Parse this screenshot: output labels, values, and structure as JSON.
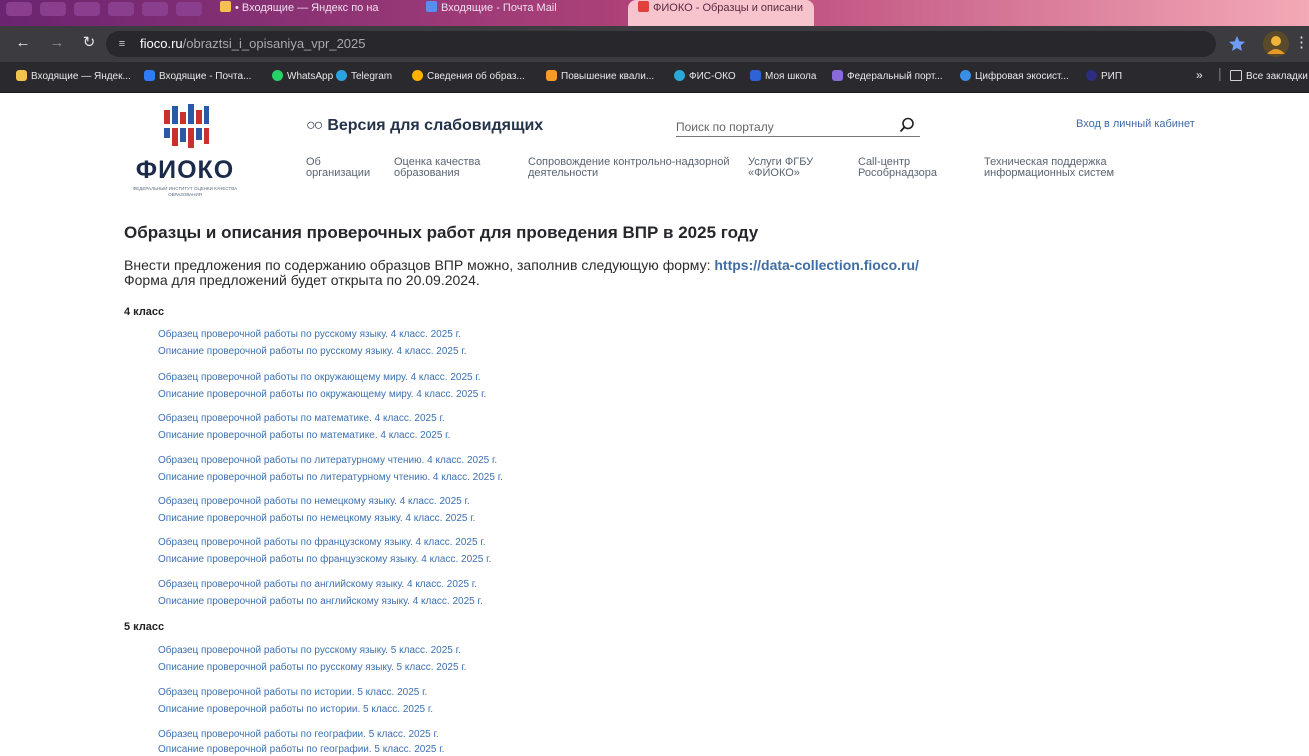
{
  "browser": {
    "tabs": [
      {
        "title": "• Входящие — Яндекс по на",
        "favicon_color": "#f2c14e",
        "active": false
      },
      {
        "title": "Входящие - Почта Mail",
        "favicon_color": "#5a8df0",
        "active": false
      },
      {
        "title": "ФИОКО - Образцы и описани",
        "favicon_color": "#e0413a",
        "active": true
      }
    ],
    "url_host": "fioco.ru",
    "url_path": "/obraztsi_i_opisaniya_vpr_2025",
    "bookmarks": [
      {
        "label": "Входящие — Яндек...",
        "color": "#f2c14e"
      },
      {
        "label": "Входящие - Почта...",
        "color": "#2f7cf6"
      },
      {
        "label": "WhatsApp",
        "color": "#25d366"
      },
      {
        "label": "Telegram",
        "color": "#2aa3e0"
      },
      {
        "label": "Сведения об образ...",
        "color": "#ffb300"
      },
      {
        "label": "Повышение квали...",
        "color": "#f59b2a"
      },
      {
        "label": "ФИС-ОКО",
        "color": "#2aa8d8"
      },
      {
        "label": "Моя школа",
        "color": "#2f62d6"
      },
      {
        "label": "Федеральный порт...",
        "color": "#8a6ad8"
      },
      {
        "label": "Цифровая экосист...",
        "color": "#3a8ee6"
      },
      {
        "label": "РИП",
        "color": "#2c2c80"
      }
    ],
    "bookmarks_overflow": "»",
    "all_bookmarks": "Все закладки"
  },
  "header": {
    "logo_text": "ФИОКО",
    "logo_subtitle": "Федеральный институт оценки качества образования",
    "low_vision": "Версия для слабовидящих",
    "search_placeholder": "Поиск по порталу",
    "login": "Вход в личный кабинет",
    "nav": [
      "Об\nорганизации",
      "Оценка качества\nобразования",
      "Сопровождение контрольно-надзорной\nдеятельности",
      "Услуги ФГБУ\n«ФИОКО»",
      "Call-центр\nРособрнадзора",
      "Техническая поддержка\nинформационных систем"
    ]
  },
  "main": {
    "title": "Образцы и описания проверочных работ для проведения ВПР в 2025 году",
    "intro_text": "Внести предложения по содержанию образцов ВПР можно, заполнив следующую форму: ",
    "intro_link": "https://data-collection.fioco.ru/",
    "intro_line2": "Форма для предложений будет открыта по 20.09.2024.",
    "grades": [
      {
        "label": "4 класс",
        "links": [
          "Образец проверочной работы по русскому языку. 4 класс. 2025 г.",
          "Описание проверочной работы по русскому языку. 4 класс. 2025 г.",
          "Образец проверочной работы по окружающему миру. 4 класс. 2025 г.",
          "Описание проверочной работы по окружающему миру. 4 класс. 2025 г.",
          "Образец проверочной работы по математике. 4 класс. 2025 г.",
          "Описание проверочной работы по математике. 4 класс. 2025 г.",
          "Образец проверочной работы по литературному чтению. 4 класс. 2025 г.",
          "Описание проверочной работы по литературному чтению. 4 класс. 2025 г.",
          "Образец проверочной работы по немецкому языку. 4 класс. 2025 г.",
          "Описание проверочной работы по немецкому языку. 4 класс. 2025 г.",
          "Образец проверочной работы по французскому языку. 4 класс. 2025 г.",
          "Описание проверочной работы по французскому языку. 4 класс. 2025 г.",
          "Образец проверочной работы по английскому языку. 4 класс. 2025 г.",
          "Описание проверочной работы по английскому языку. 4 класс. 2025 г."
        ]
      },
      {
        "label": "5 класс",
        "links": [
          "Образец проверочной работы по русскому языку. 5 класс. 2025 г.",
          "Описание проверочной работы по русскому языку. 5 класс. 2025 г.",
          "Образец проверочной работы по истории. 5 класс. 2025 г.",
          "Описание проверочной работы по истории. 5 класс. 2025 г.",
          "Образец проверочной работы по географии. 5 класс. 2025 г.",
          "Описание проверочной работы по географии. 5 класс. 2025 г."
        ]
      }
    ]
  }
}
